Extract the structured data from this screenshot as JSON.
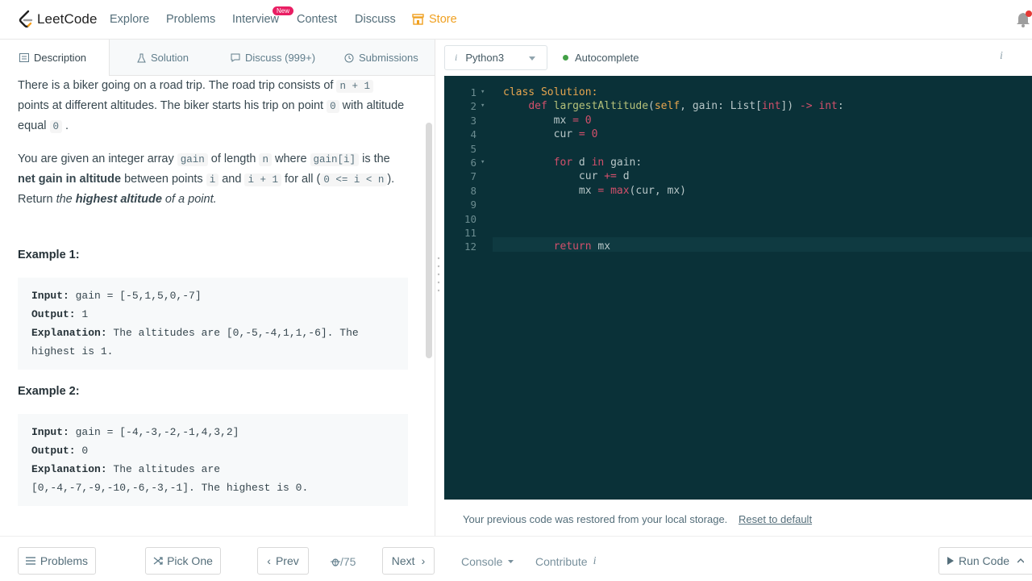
{
  "nav": {
    "brand": "LeetCode",
    "items": [
      "Explore",
      "Problems",
      "Interview",
      "Contest",
      "Discuss",
      "Store"
    ],
    "new_badge": "New"
  },
  "tabs": [
    {
      "label": "Description",
      "active": true
    },
    {
      "label": "Solution",
      "active": false
    },
    {
      "label": "Discuss (999+)",
      "active": false
    },
    {
      "label": "Submissions",
      "active": false
    }
  ],
  "problem": {
    "p1_a": "There is a biker going on a road trip. The road trip consists of ",
    "p1_code_n1": "n + 1",
    "p1_b": " points at different altitudes. The biker starts his trip on point ",
    "p1_code_0": "0",
    "p1_c": " with altitude equal ",
    "p1_code_0b": "0",
    "p1_d": " .",
    "p2_a": "You are given an integer array ",
    "p2_code_gain": "gain",
    "p2_b": " of length ",
    "p2_code_n": "n",
    "p2_c": " where ",
    "p2_code_gaini": "gain[i]",
    "p2_d": " is the ",
    "p2_bold": "net gain in altitude",
    "p2_e": " between points ",
    "p2_code_i": "i",
    "p2_f": " and ",
    "p2_code_i1": "i + 1",
    "p2_g": " for all (",
    "p2_code_range": "0 <= i < n",
    "p2_h": "). Return ",
    "p2_ital": "the ",
    "p2_bold2": "highest altitude",
    "p2_ital2": " of a point.",
    "ex1_title": "Example 1:",
    "ex1_input_label": "Input:",
    "ex1_input": " gain = [-5,1,5,0,-7]",
    "ex1_output_label": "Output:",
    "ex1_output": " 1",
    "ex1_expl_label": "Explanation:",
    "ex1_expl_line1": " The altitudes are [0,-5,-4,1,1,-6]. The",
    "ex1_expl_line2": "highest is 1.",
    "ex2_title": "Example 2:",
    "ex2_input_label": "Input:",
    "ex2_input": " gain = [-4,-3,-2,-1,4,3,2]",
    "ex2_output_label": "Output:",
    "ex2_output": " 0",
    "ex2_expl_label": "Explanation:",
    "ex2_expl_line1": " The altitudes are",
    "ex2_expl_line2": "[0,-4,-7,-9,-10,-6,-3,-1]. The highest is 0."
  },
  "editor": {
    "language": "Python3",
    "autocomplete": "Autocomplete",
    "line_numbers": [
      "1",
      "2",
      "3",
      "4",
      "5",
      "6",
      "7",
      "8",
      "9",
      "10",
      "11",
      "12"
    ],
    "restore_message": "Your previous code was restored from your local storage.",
    "reset_link": "Reset to default"
  },
  "footer": {
    "problems": "Problems",
    "pick_one": "Pick One",
    "prev": "Prev",
    "page": "/75",
    "next": "Next",
    "console": "Console",
    "contribute": "Contribute",
    "run_code": "Run Code"
  }
}
